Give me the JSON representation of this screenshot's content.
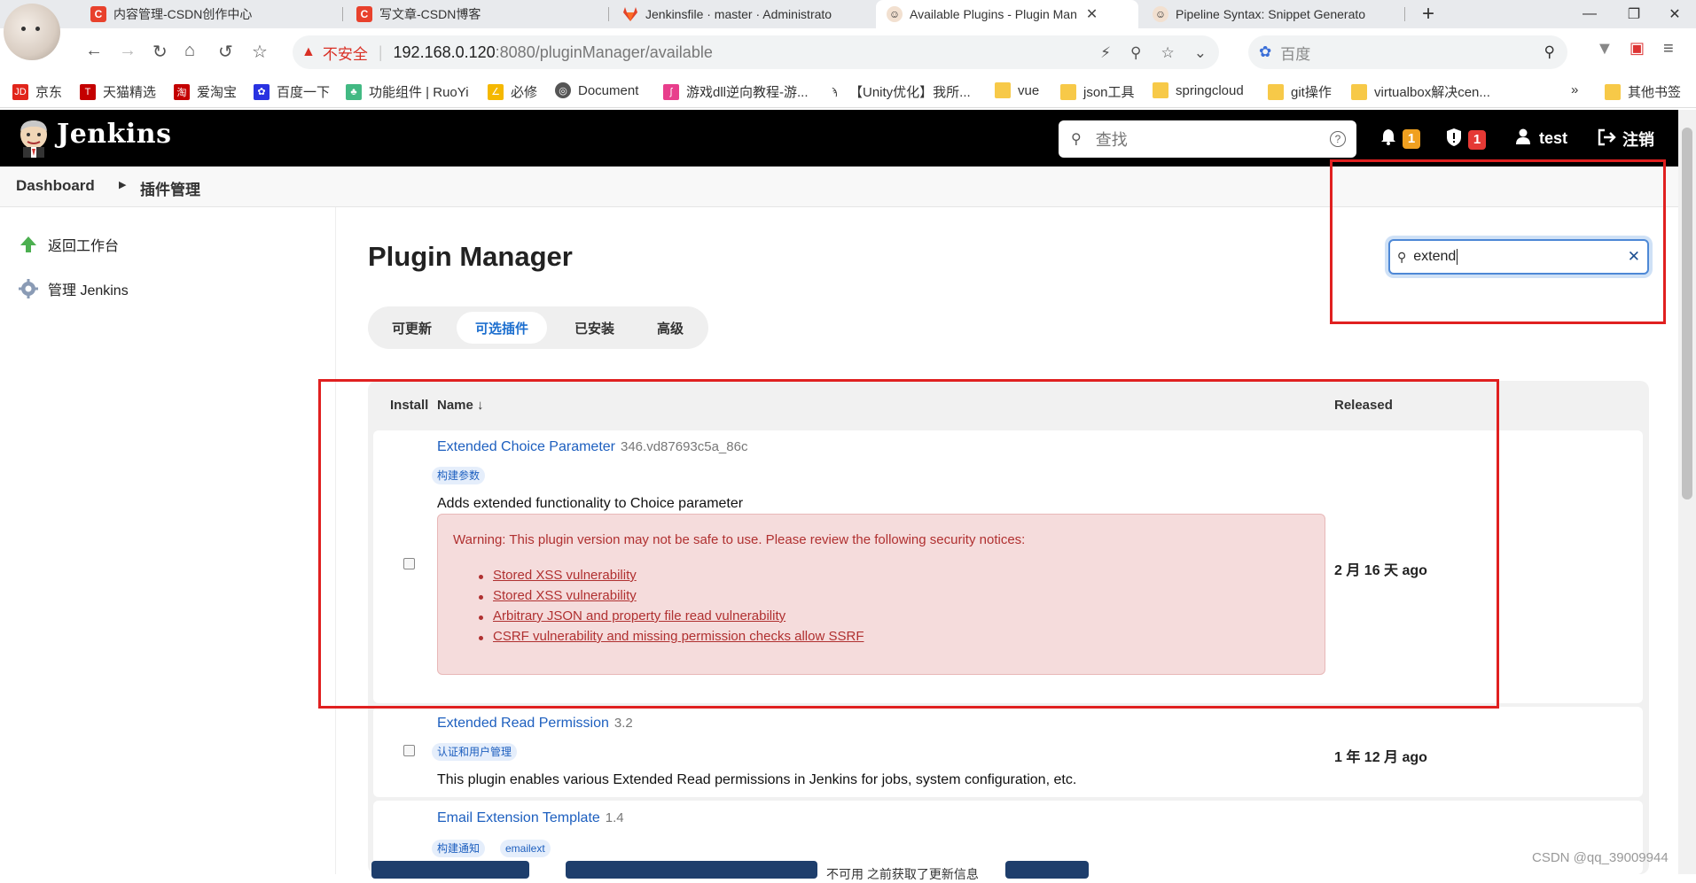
{
  "browser": {
    "tabs": [
      {
        "title": "内容管理-CSDN创作中心",
        "icon": "csdn-icon",
        "color": "#e8412c",
        "active": false
      },
      {
        "title": "写文章-CSDN博客",
        "icon": "csdn-icon",
        "color": "#e8412c",
        "active": false
      },
      {
        "title": "Jenkinsfile · master · Administrato",
        "icon": "gitlab-icon",
        "color": "#e24329",
        "active": false
      },
      {
        "title": "Available Plugins - Plugin Man",
        "icon": "jenkins-icon",
        "color": "#d33833",
        "active": true
      },
      {
        "title": "Pipeline Syntax: Snippet Generato",
        "icon": "jenkins-icon",
        "color": "#d33833",
        "active": false
      }
    ],
    "address": {
      "security_label": "不安全",
      "host": "192.168.0.120",
      "path": ":8080/pluginManager/available"
    },
    "search_placeholder": "百度",
    "bookmarks": [
      "京东",
      "天猫精选",
      "爱淘宝",
      "百度一下",
      "功能组件 | RuoYi",
      "必修",
      "Document",
      "游戏dll逆向教程-游...",
      "【Unity优化】我所...",
      "vue",
      "json工具",
      "springcloud",
      "git操作",
      "virtualbox解决cen...",
      "»",
      "其他书签"
    ]
  },
  "jenkins": {
    "title": "Jenkins",
    "search_placeholder": "查找",
    "notifications": "1",
    "security_alerts": "1",
    "user": "test",
    "logout": "注销"
  },
  "breadcrumbs": [
    "Dashboard",
    "插件管理"
  ],
  "sidebar": [
    {
      "label": "返回工作台",
      "icon": "arrow-up-icon"
    },
    {
      "label": "管理 Jenkins",
      "icon": "gear-icon"
    }
  ],
  "main": {
    "title": "Plugin Manager",
    "tabs": [
      "可更新",
      "可选插件",
      "已安装",
      "高级"
    ],
    "active_tab": 1,
    "filter_value": "extend",
    "columns": {
      "install": "Install",
      "name": "Name ↓",
      "released": "Released"
    },
    "plugins": [
      {
        "name": "Extended Choice Parameter",
        "version": "346.vd87693c5a_86c",
        "tags": [
          "构建参数"
        ],
        "description": "Adds extended functionality to Choice parameter",
        "warning": "Warning: This plugin version may not be safe to use. Please review the following security notices:",
        "notices": [
          "Stored XSS vulnerability",
          "Stored XSS vulnerability",
          "Arbitrary JSON and property file read vulnerability",
          "CSRF vulnerability and missing permission checks allow SSRF"
        ],
        "released": "2 月 16 天 ago"
      },
      {
        "name": "Extended Read Permission",
        "version": "3.2",
        "tags": [
          "认证和用户管理"
        ],
        "description": "This plugin enables various Extended Read permissions in Jenkins for jobs, system configuration, etc.",
        "released": "1 年 12 月 ago"
      },
      {
        "name": "Email Extension Template",
        "version": "1.4",
        "tags": [
          "构建通知",
          "emailext"
        ],
        "description": "",
        "released": ""
      }
    ],
    "bottom_text": "不可用 之前获取了更新信息"
  },
  "watermark": "CSDN @qq_39009944"
}
